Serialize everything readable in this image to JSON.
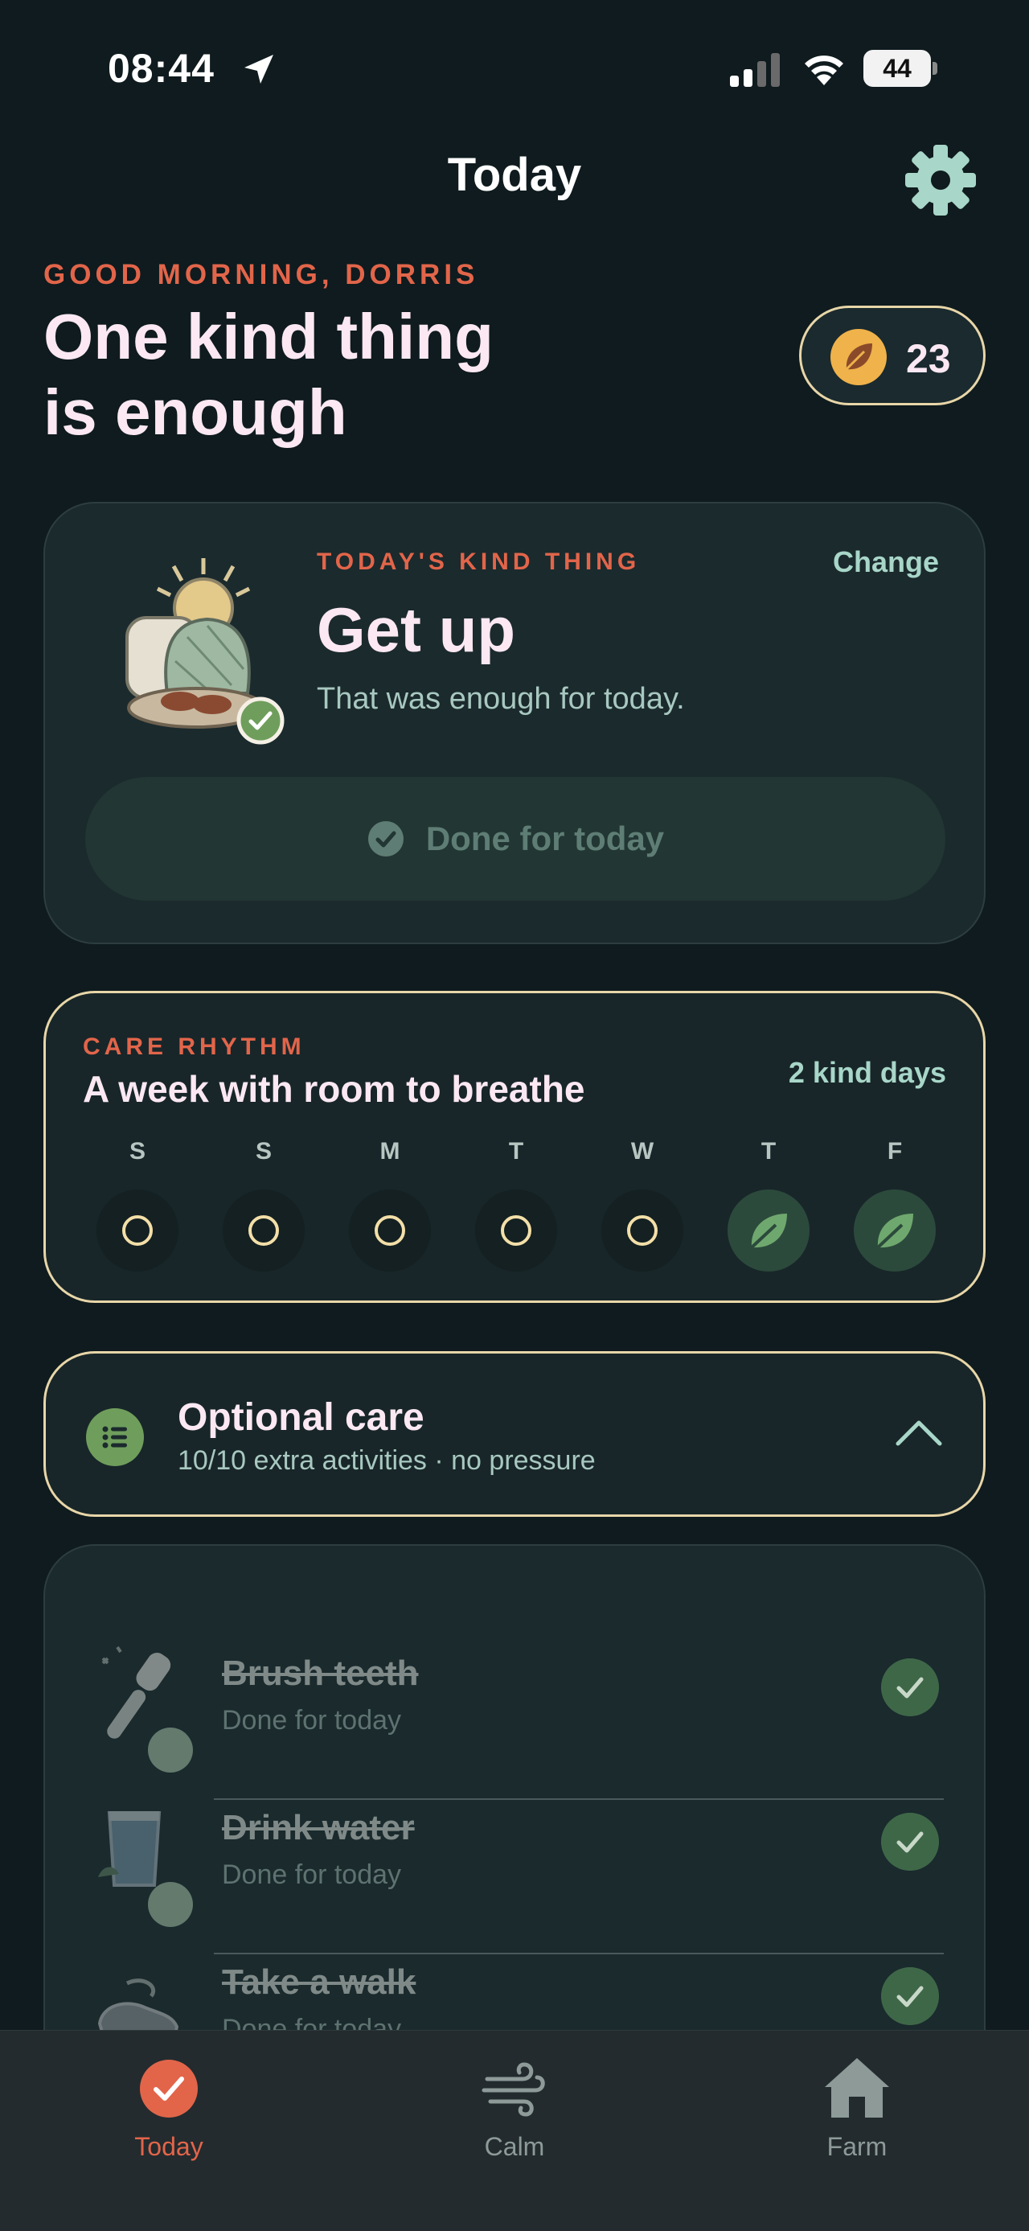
{
  "status_bar": {
    "time": "08:44",
    "battery": "44"
  },
  "nav": {
    "title": "Today"
  },
  "header": {
    "greeting": "GOOD MORNING, DORRIS",
    "headline_line1": "One kind thing",
    "headline_line2": "is enough",
    "leaf_count": "23"
  },
  "kind_card": {
    "label": "TODAY'S KIND THING",
    "change_label": "Change",
    "title": "Get up",
    "subtitle": "That was enough for today.",
    "done_button": "Done for today"
  },
  "rhythm": {
    "label": "CARE RHYTHM",
    "title": "A week with room to breathe",
    "kind_days": "2 kind days",
    "days": [
      {
        "letter": "S",
        "state": "open"
      },
      {
        "letter": "S",
        "state": "open"
      },
      {
        "letter": "M",
        "state": "open"
      },
      {
        "letter": "T",
        "state": "open"
      },
      {
        "letter": "W",
        "state": "open"
      },
      {
        "letter": "T",
        "state": "leaf"
      },
      {
        "letter": "F",
        "state": "leaf"
      }
    ]
  },
  "optional": {
    "title": "Optional care",
    "subtitle": "10/10 extra activities · no pressure"
  },
  "activities": [
    {
      "title": "Brush teeth",
      "status": "Done for today",
      "icon": "toothbrush-icon"
    },
    {
      "title": "Drink water",
      "status": "Done for today",
      "icon": "water-glass-icon"
    },
    {
      "title": "Take a walk",
      "status": "Done for today",
      "icon": "shoes-icon"
    }
  ],
  "tabs": [
    {
      "label": "Today",
      "icon": "check-circle-icon",
      "active": true
    },
    {
      "label": "Calm",
      "icon": "wind-icon",
      "active": false
    },
    {
      "label": "Farm",
      "icon": "house-icon",
      "active": false
    }
  ],
  "colors": {
    "background": "#0f1b1e",
    "accent": "#e2654a",
    "card": "#1b2a2d",
    "outline": "#e8d6a8",
    "mint": "#a8d6c8"
  }
}
